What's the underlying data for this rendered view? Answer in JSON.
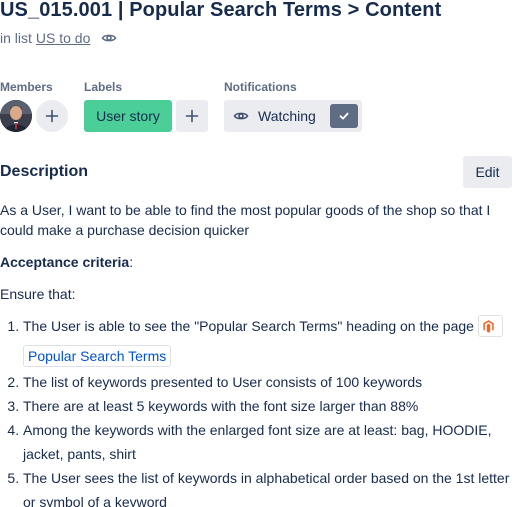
{
  "card": {
    "title": "US_015.001 | Popular Search Terms > Content",
    "in_list_prefix": "in list",
    "list_name": "US to do"
  },
  "members": {
    "heading": "Members"
  },
  "labels": {
    "heading": "Labels",
    "items": [
      {
        "text": "User story",
        "color": "#4bce97"
      }
    ]
  },
  "notifications": {
    "heading": "Notifications",
    "watch_label": "Watching",
    "watching": true
  },
  "description": {
    "heading": "Description",
    "edit_label": "Edit",
    "intro": "As a User, I want to be able to find the most popular goods of the shop so that I could make a purchase decision quicker",
    "criteria_heading": "Acceptance criteria",
    "criteria_colon": ":",
    "ensure": "Ensure that:",
    "items": [
      {
        "text": "The User is able to see the \"Popular Search Terms\" heading on the page ",
        "link_text": "Popular Search Terms",
        "link_icon": "magento-icon"
      },
      {
        "text": "The list of keywords presented to User consists of 100 keywords"
      },
      {
        "text": "There are at least 5 keywords with the font size larger than 88%"
      },
      {
        "text": "Among the keywords with the enlarged font size are at least: bag, HOODIE, jacket, pants, shirt"
      },
      {
        "text": "The User sees the list of keywords in alphabetical order based on the 1st letter or symbol of a keyword"
      }
    ]
  },
  "colors": {
    "text": "#172b4d",
    "muted": "#5e6c84",
    "button_bg": "#ebecf0",
    "label_green": "#4bce97",
    "link": "#0052cc",
    "magento_orange": "#f26322"
  }
}
